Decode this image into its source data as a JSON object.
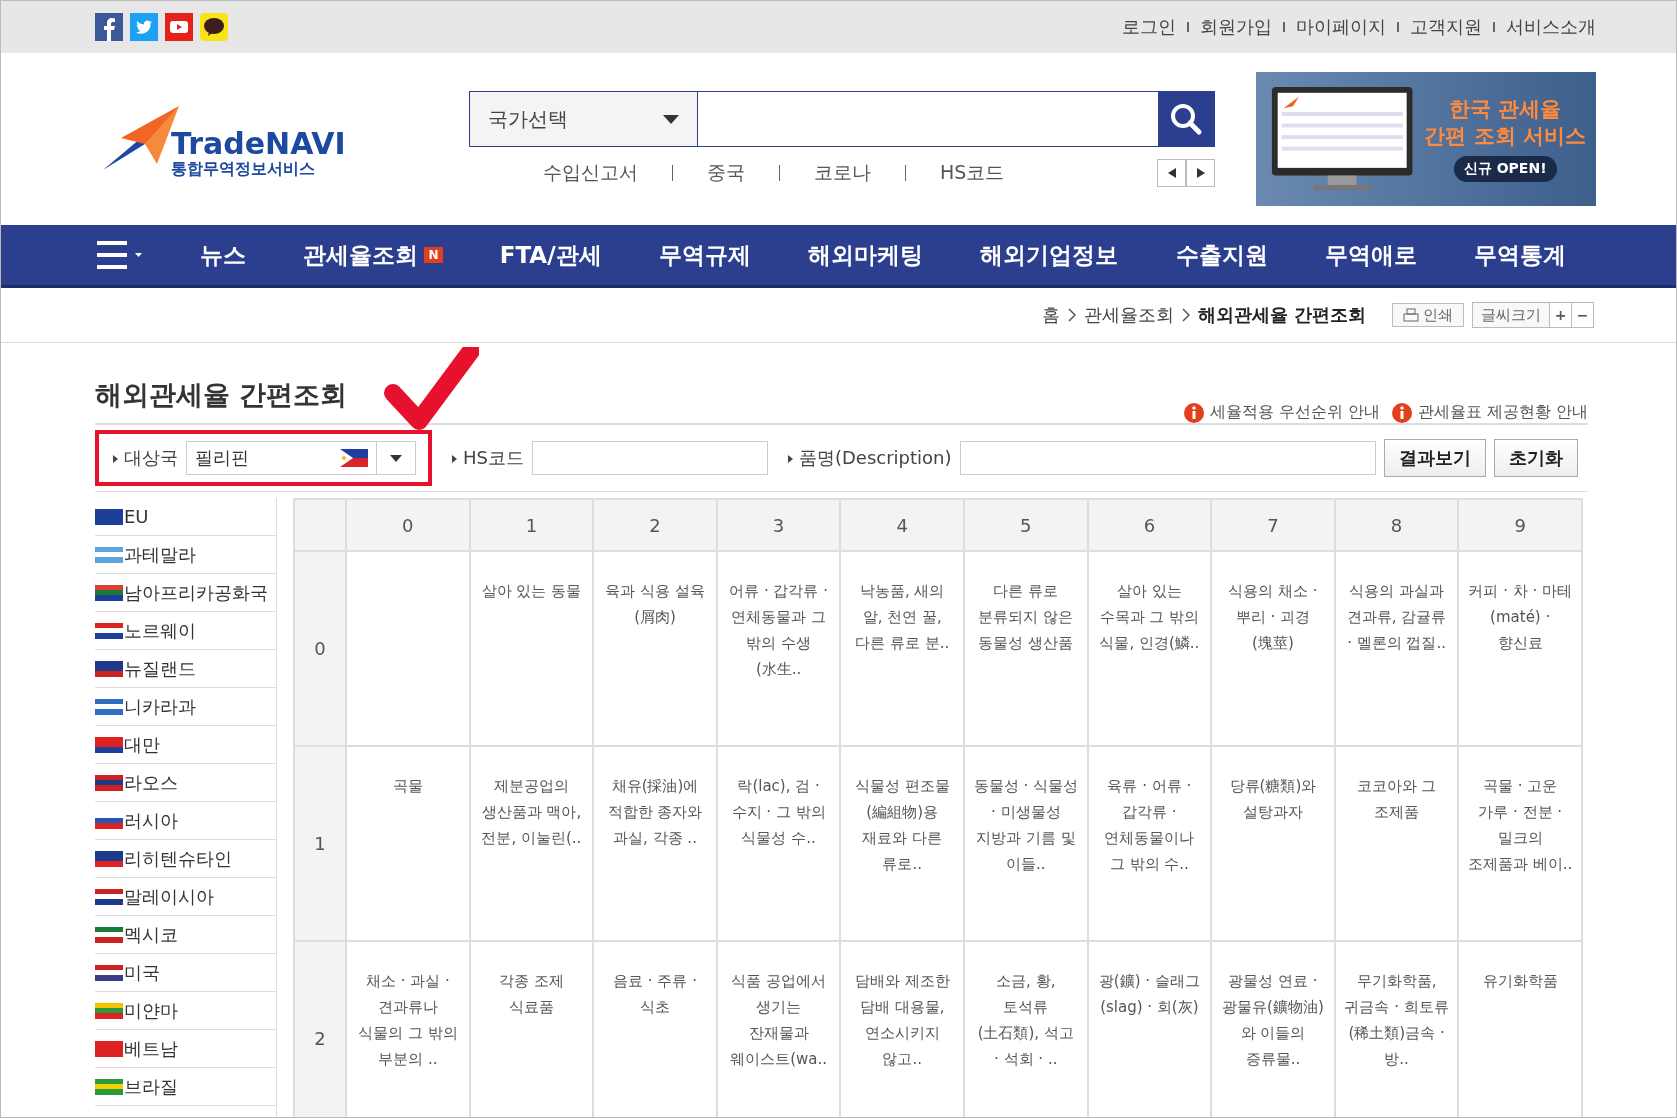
{
  "top_links": [
    "로그인",
    "회원가입",
    "마이페이지",
    "고객지원",
    "서비스소개"
  ],
  "logo": {
    "name": "TradeNAVI",
    "subtitle": "통합무역정보서비스"
  },
  "search": {
    "country_select": "국가선택"
  },
  "keywords": [
    "수입신고서",
    "중국",
    "코로나",
    "HS코드"
  ],
  "banner": {
    "title_lines": [
      "한국 관세율",
      "간편 조회 서비스"
    ],
    "badge": "신규 OPEN!"
  },
  "nav": [
    {
      "label": "뉴스"
    },
    {
      "label": "관세율조회",
      "badge": "N"
    },
    {
      "label": "FTA/관세"
    },
    {
      "label": "무역규제"
    },
    {
      "label": "해외마케팅"
    },
    {
      "label": "해외기업정보"
    },
    {
      "label": "수출지원"
    },
    {
      "label": "무역애로"
    },
    {
      "label": "무역통계"
    }
  ],
  "breadcrumb": [
    "홈",
    "관세율조회",
    "해외관세율 간편조회"
  ],
  "tools": {
    "print": "인쇄",
    "font_size": "글씨크기",
    "increase": "+",
    "decrease": "−"
  },
  "page_title": "해외관세율 간편조회",
  "info_links": [
    "세율적용 우선순위 안내",
    "관세율표 제공현황 안내"
  ],
  "filter": {
    "country_label": "대상국",
    "country_value": "필리핀",
    "hs_label": "HS코드",
    "desc_label": "품명(Description)",
    "search_button": "결과보기",
    "reset_button": "초기화"
  },
  "countries": [
    "EU",
    "과테말라",
    "남아프리카공화국",
    "노르웨이",
    "뉴질랜드",
    "니카라과",
    "대만",
    "라오스",
    "러시아",
    "리히텐슈타인",
    "말레이시아",
    "멕시코",
    "미국",
    "미얀마",
    "베트남",
    "브라질"
  ],
  "table": {
    "columns": [
      "0",
      "1",
      "2",
      "3",
      "4",
      "5",
      "6",
      "7",
      "8",
      "9"
    ],
    "rows": [
      {
        "header": "0",
        "cells": [
          "",
          "살아 있는 동물",
          "육과 식용 설육(屑肉)",
          "어류 · 갑각류 · 연체동물과 그 밖의 수생(水生..",
          "낙농품, 새의 알, 천연 꿀, 다른 류로 분..",
          "다른 류로 분류되지 않은 동물성 생산품",
          "살아 있는 수목과 그 밖의 식물, 인경(鱗..",
          "식용의 채소 · 뿌리 · 괴경(塊莖)",
          "식용의 과실과 견과류, 감귤류 · 멜론의 껍질..",
          "커피 · 차 · 마테(maté) · 향신료"
        ]
      },
      {
        "header": "1",
        "cells": [
          "곡물",
          "제분공업의 생산품과 맥아, 전분, 이눌린(..",
          "채유(採油)에 적합한 종자와 과실, 각종 ..",
          "락(lac), 검 · 수지 · 그 밖의 식물성 수..",
          "식물성 편조물(編組物)용 재료와 다른 류로..",
          "동물성 · 식물성 · 미생물성 지방과 기름 및 이들..",
          "육류 · 어류 · 갑각류 · 연체동물이나 그 밖의 수..",
          "당류(糖類)와 설탕과자",
          "코코아와 그 조제품",
          "곡물 · 고운 가루 · 전분 · 밀크의 조제품과 베이.."
        ]
      },
      {
        "header": "2",
        "cells": [
          "채소 · 과실 · 견과류나 식물의 그 밖의 부분의 ..",
          "각종 조제 식료품",
          "음료 · 주류 · 식초",
          "식품 공업에서 생기는 잔재물과 웨이스트(wa..",
          "담배와 제조한 담배 대용물, 연소시키지 않고..",
          "소금, 황, 토석류(土石類), 석고 · 석회 · ..",
          "광(鑛) · 슬래그(slag) · 회(灰)",
          "광물성 연료 · 광물유(鑛物油)와 이들의 증류물..",
          "무기화학품, 귀금속 · 희토류(稀土類)금속 · 방..",
          "유기화학품"
        ]
      }
    ]
  }
}
